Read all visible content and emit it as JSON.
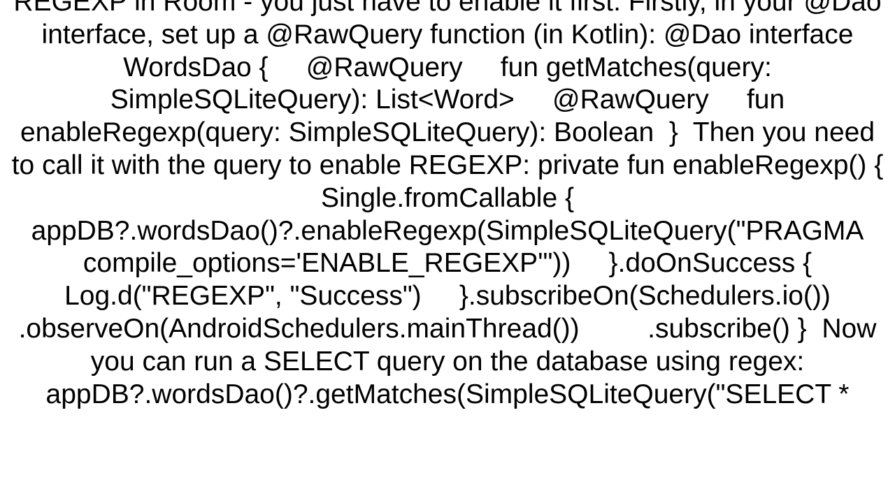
{
  "document": {
    "body_text": "REGEXP in Room - you just have to enable it first. Firstly, in your @Dao interface, set up a @RawQuery function (in Kotlin): @Dao interface WordsDao {     @RawQuery     fun getMatches(query: SimpleSQLiteQuery): List<Word>     @RawQuery     fun enableRegexp(query: SimpleSQLiteQuery): Boolean  }  Then you need to call it with the query to enable REGEXP: private fun enableRegexp() {     Single.fromCallable {         appDB?.wordsDao()?.enableRegexp(SimpleSQLiteQuery(\"PRAGMA compile_options='ENABLE_REGEXP'\"))     }.doOnSuccess {         Log.d(\"REGEXP\", \"Success\")     }.subscribeOn(Schedulers.io())         .observeOn(AndroidSchedulers.mainThread())         .subscribe() }  Now you can run a SELECT query on the database using regex: appDB?.wordsDao()?.getMatches(SimpleSQLiteQuery(\"SELECT *"
  }
}
